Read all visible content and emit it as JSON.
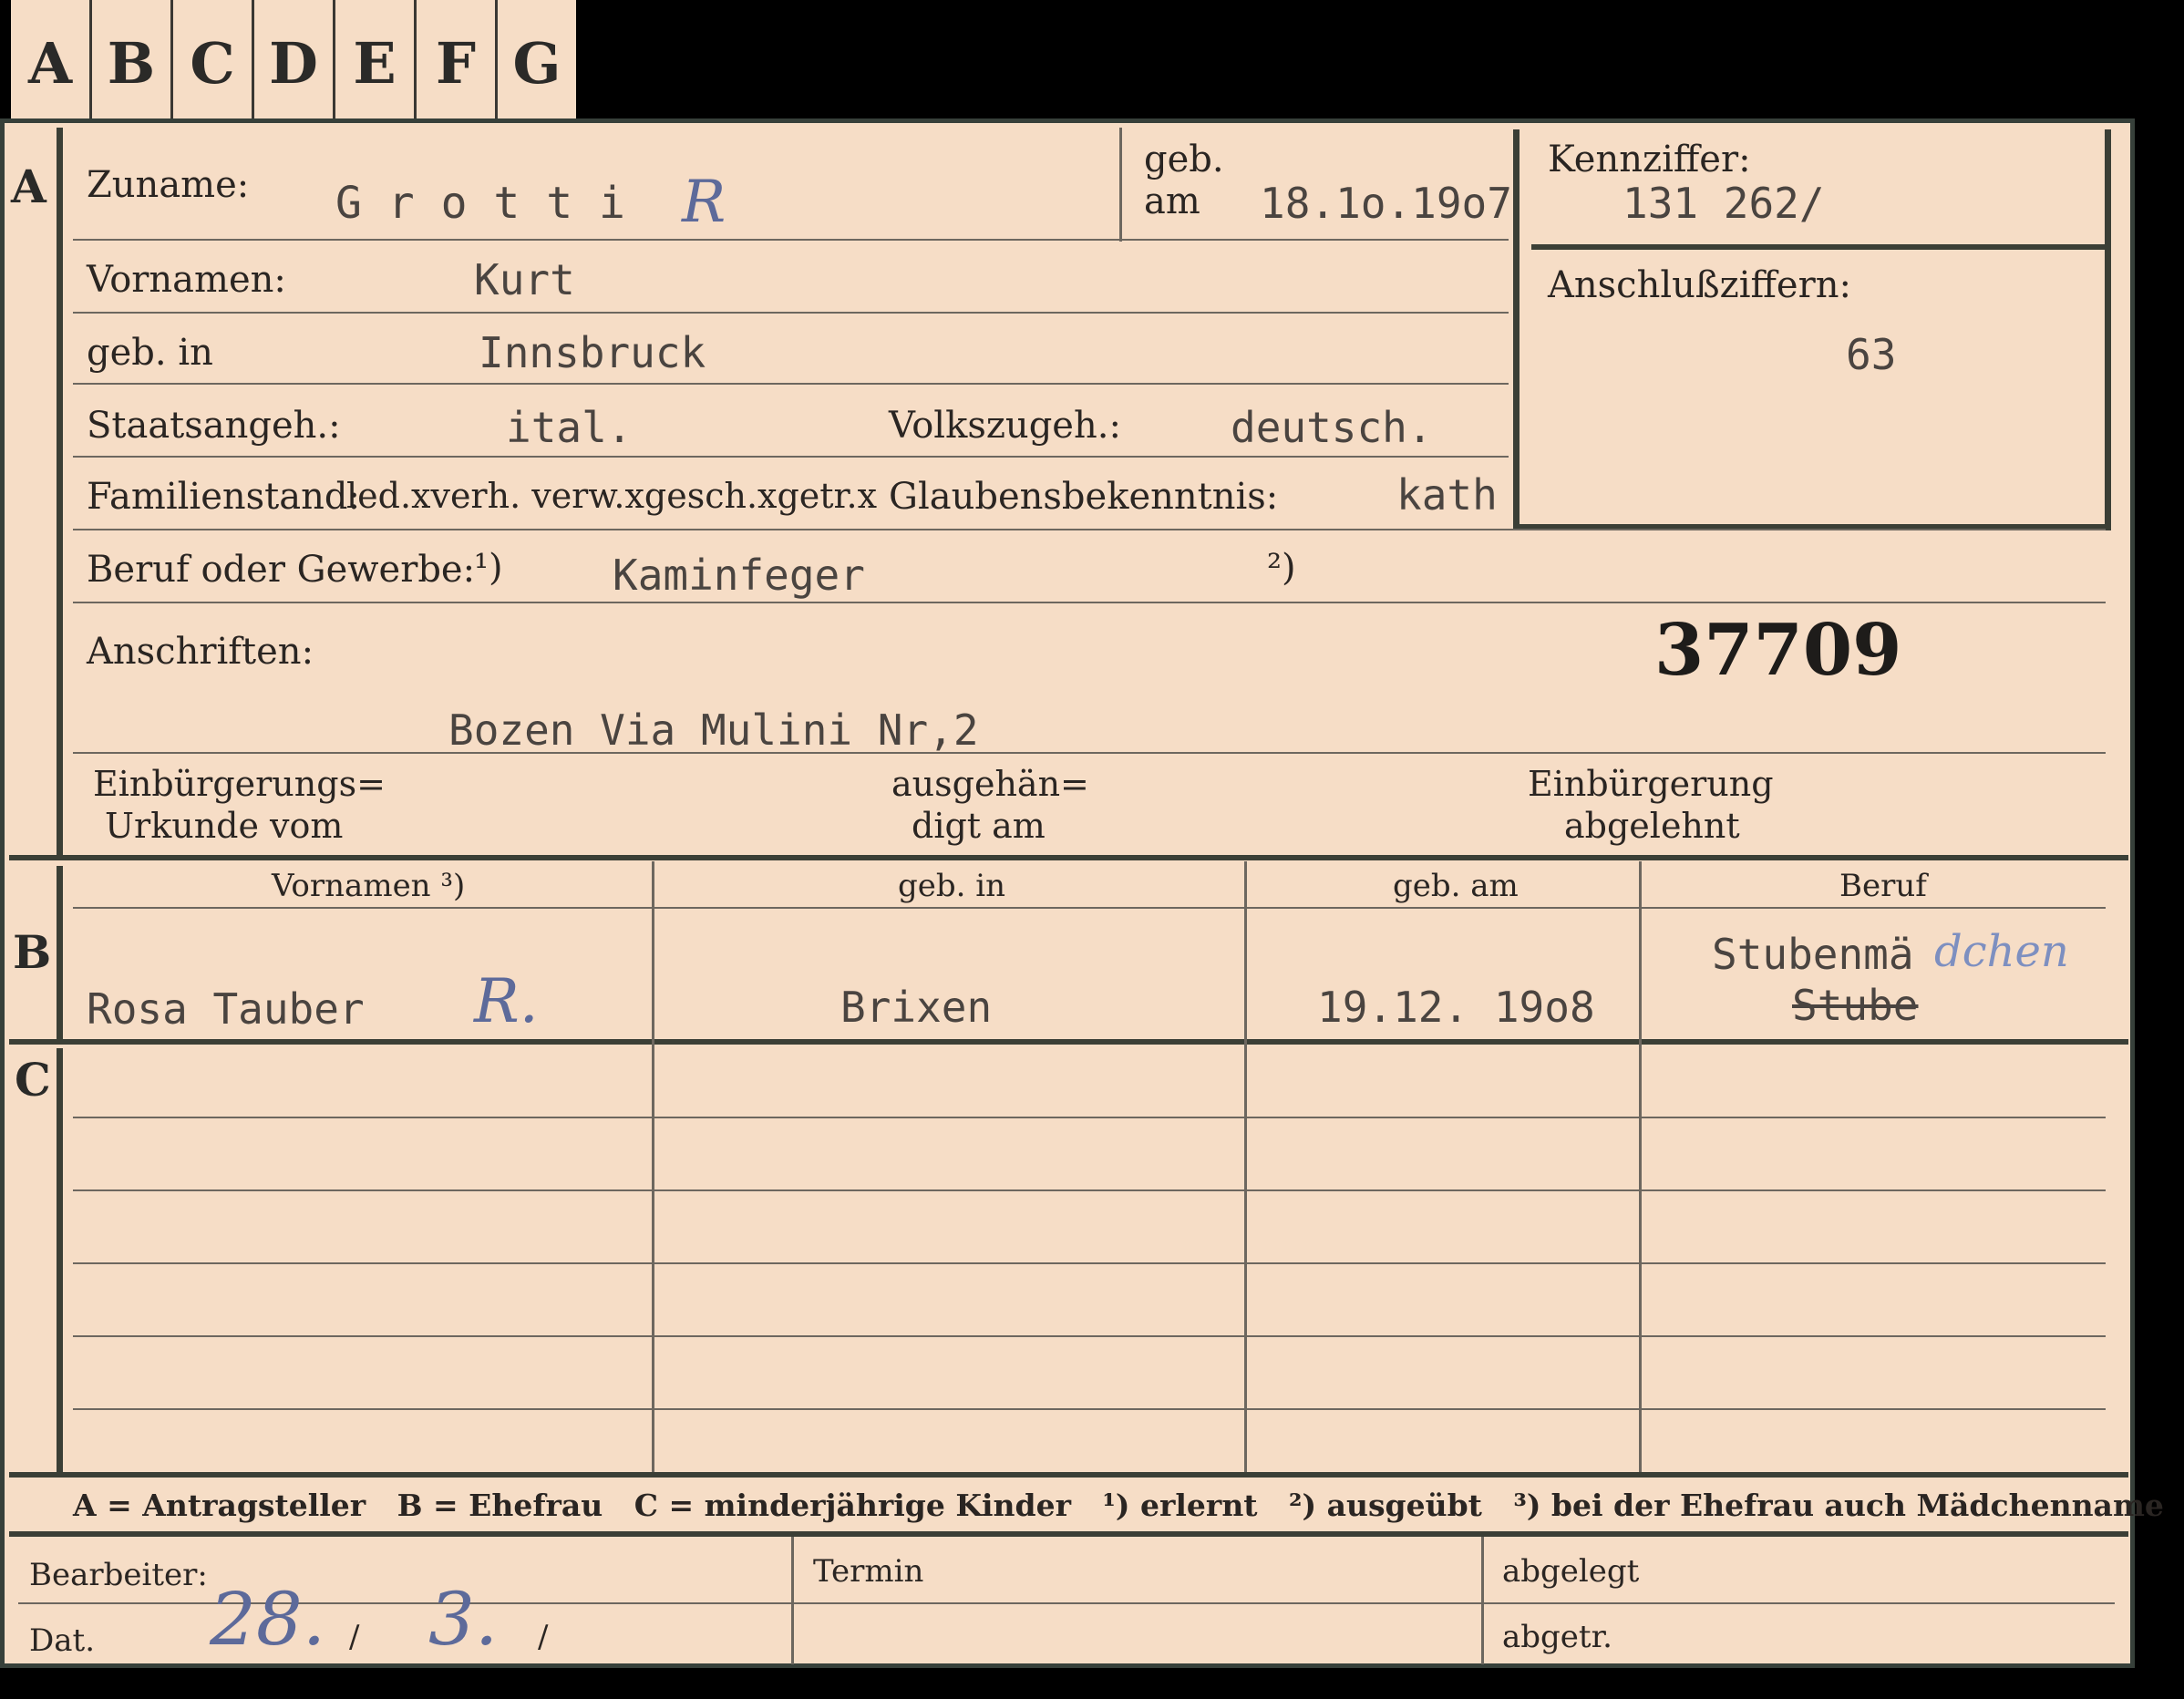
{
  "tabs": [
    "A",
    "B",
    "C",
    "D",
    "E",
    "F",
    "G"
  ],
  "section_a": {
    "marker": "A",
    "zuname_label": "Zuname:",
    "zuname_value": "G r o t t i",
    "zuname_mark": "R",
    "geb_am_label_1": "geb.",
    "geb_am_label_2": "am",
    "geb_am_value": "18.1o.19o7",
    "kennziffer_label": "Kennziffer:",
    "kennziffer_value": "131 262/",
    "anschluss_label": "Anschlußziffern:",
    "anschluss_value": "63",
    "vornamen_label": "Vornamen:",
    "vornamen_value": "Kurt",
    "geb_in_label": "geb. in",
    "geb_in_value": "Innsbruck",
    "staatsangeh_label": "Staatsangeh.:",
    "staatsangeh_value": "ital.",
    "volkszugeh_label": "Volkszugeh.:",
    "volkszugeh_value": "deutsch.",
    "familienstand_label": "Familienstand:",
    "familienstand_options": "led.xverh. verw.xgesch.xgetr.x",
    "glauben_label": "Glaubensbekenntnis:",
    "glauben_value": "kath",
    "beruf_label": "Beruf oder Gewerbe:",
    "beruf_fn1": "¹)",
    "beruf_value": "Kaminfeger",
    "beruf_fn2": "²)",
    "anschriften_label": "Anschriften:",
    "card_number": "37709",
    "anschrift_value": "Bozen Via Mulini Nr,2",
    "einb_urkunde_1": "Einbürgerungs=",
    "einb_urkunde_2": "Urkunde vom",
    "ausgeh_1": "ausgehän=",
    "ausgeh_2": "digt am",
    "einb_abgelehnt_1": "Einbürgerung",
    "einb_abgelehnt_2": "abgelehnt"
  },
  "section_b": {
    "marker": "B",
    "headers": [
      "Vornamen ³)",
      "geb. in",
      "geb. am",
      "Beruf"
    ],
    "vornamen": "Rosa Tauber",
    "vornamen_mark": "R.",
    "geb_in": "Brixen",
    "geb_am": "19.12. 19o8",
    "beruf_1": "Stubenmä",
    "beruf_1_hand": "dchen",
    "beruf_2": "Stube"
  },
  "section_c": {
    "marker": "C"
  },
  "legend": "A = Antragsteller   B = Ehefrau   C = minderjährige Kinder   ¹) erlernt   ²) ausgeübt   ³) bei der Ehefrau auch Mädchenname",
  "footer": {
    "bearbeiter_label": "Bearbeiter:",
    "dat_label": "Dat.",
    "dat_day": "28.",
    "dat_month": "3.",
    "dat_sep1": "/",
    "dat_sep2": "/",
    "termin_label": "Termin",
    "abgelegt_label": "abgelegt",
    "abgetr_label": "abgetr."
  }
}
